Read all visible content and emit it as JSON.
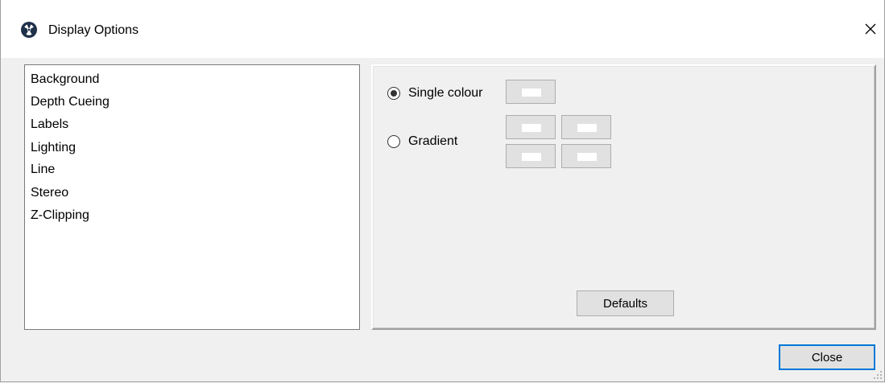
{
  "window": {
    "title": "Display Options",
    "close_glyph": "✕",
    "app_icon": "radiation-icon"
  },
  "categories": [
    {
      "label": "Background"
    },
    {
      "label": "Depth Cueing"
    },
    {
      "label": "Labels"
    },
    {
      "label": "Lighting"
    },
    {
      "label": "Line"
    },
    {
      "label": "Stereo"
    },
    {
      "label": "Z-Clipping"
    }
  ],
  "background": {
    "single_colour_label": "Single colour",
    "single_colour_selected": true,
    "gradient_label": "Gradient",
    "gradient_selected": false,
    "single_colour": "#ffffff",
    "gradient_colours": [
      "#ffffff",
      "#ffffff",
      "#ffffff",
      "#ffffff"
    ]
  },
  "buttons": {
    "defaults_label": "Defaults",
    "close_label": "Close"
  }
}
